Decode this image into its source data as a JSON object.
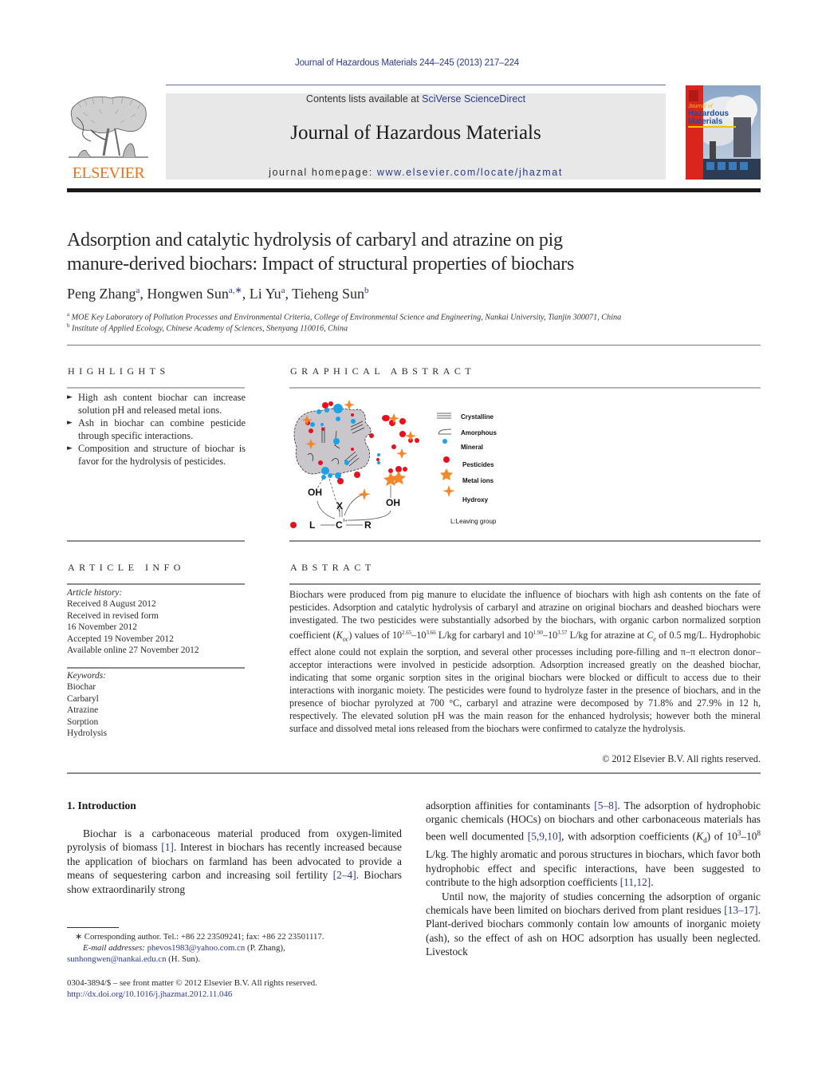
{
  "header": {
    "running_head": "Journal of Hazardous Materials 244–245 (2013) 217–224",
    "contents_prefix": "Contents lists available at ",
    "contents_link": "SciVerse ScienceDirect",
    "journal_title": "Journal of Hazardous Materials",
    "homepage_prefix": "journal homepage: ",
    "homepage_link": "www.elsevier.com/locate/jhazmat",
    "publisher_logo_text": "ELSEVIER",
    "cover": {
      "line1": "Journal of",
      "line2": "Hazardous",
      "line3": "Materials"
    }
  },
  "article": {
    "title_line1": "Adsorption and catalytic hydrolysis of carbaryl and atrazine on pig",
    "title_line2": "manure-derived biochars: Impact of structural properties of biochars",
    "authors": [
      {
        "name": "Peng Zhang",
        "sup": "a"
      },
      {
        "name": "Hongwen Sun",
        "sup": "a,∗"
      },
      {
        "name": "Li Yu",
        "sup": "a"
      },
      {
        "name": "Tieheng Sun",
        "sup": "b"
      }
    ],
    "affiliations": [
      {
        "sup": "a",
        "text": "MOE Key Laboratory of Pollution Processes and Environmental Criteria, College of Environmental Science and Engineering, Nankai University, Tianjin 300071, China"
      },
      {
        "sup": "b",
        "text": "Institute of Applied Ecology, Chinese Academy of Sciences, Shenyang 110016, China"
      }
    ]
  },
  "highlights": {
    "heading": "HIGHLIGHTS",
    "bullet": "►",
    "items": [
      "High ash content biochar can increase solution pH and released metal ions.",
      "Ash in biochar can combine pesticide through specific interactions.",
      "Composition and structure of biochar is favor for the hydrolysis of pesticides."
    ]
  },
  "graphical_abstract": {
    "heading": "GRAPHICAL ABSTRACT",
    "legend": [
      "Crystalline",
      "Amorphous",
      "Mineral",
      "Pesticides",
      "Metal ions",
      "Hydroxy"
    ],
    "leaving_group_note": "L:Leaving group",
    "labels": {
      "oh_left": "OH",
      "oh_right": "OH",
      "x": "X",
      "l": "L",
      "c": "C",
      "r": "R",
      "delta": "δ+"
    },
    "colors": {
      "mineral": "#1aa3e8",
      "pesticide": "#e8101c",
      "metal": "#f5862a",
      "particle": "#c9c6cc"
    }
  },
  "article_info": {
    "heading": "ARTICLE INFO",
    "history_label": "Article history:",
    "history": [
      "Received 8 August 2012",
      "Received in revised form",
      "16 November 2012",
      "Accepted 19 November 2012",
      "Available online 27 November 2012"
    ],
    "keywords_label": "Keywords:",
    "keywords": [
      "Biochar",
      "Carbaryl",
      "Atrazine",
      "Sorption",
      "Hydrolysis"
    ]
  },
  "abstract": {
    "heading": "ABSTRACT",
    "p1": "Biochars were produced from pig manure to elucidate the influence of biochars with high ash contents on the fate of pesticides. Adsorption and catalytic hydrolysis of carbaryl and atrazine on original biochars and deashed biochars were investigated. The two pesticides were substantially adsorbed by the biochars, with organic carbon normalized sorption coefficient (",
    "koc": "K",
    "koc_sub": "oc",
    "p2": ") values of 10",
    "e1": "2.65",
    "p3": "–10",
    "e2": "3.66",
    "p4": " L/kg for carbaryl and 10",
    "e3": "1.90",
    "p5": "–10",
    "e4": "3.57",
    "p6": " L/kg for atrazine at ",
    "ce": "C",
    "ce_sub": "e",
    "p7": " of 0.5 mg/L. Hydrophobic effect alone could not explain the sorption, and several other processes including pore-filling and π–π electron donor–acceptor interactions were involved in pesticide adsorption. Adsorption increased greatly on the deashed biochar, indicating that some organic sorption sites in the original biochars were blocked or difficult to access due to their interactions with inorganic moiety. The pesticides were found to hydrolyze faster in the presence of biochars, and in the presence of biochar pyrolyzed at 700 °C, carbaryl and atrazine were decomposed by 71.8% and 27.9% in 12 h, respectively. The elevated solution pH was the main reason for the enhanced hydrolysis; however both the mineral surface and dissolved metal ions released from the biochars were confirmed to catalyze the hydrolysis.",
    "copyright": "© 2012 Elsevier B.V. All rights reserved."
  },
  "introduction": {
    "heading": "1.  Introduction",
    "left_p1_a": "Biochar is a carbonaceous material produced from oxygen-limited pyrolysis of biomass ",
    "ref1": "[1]",
    "left_p1_b": ". Interest in biochars has recently increased because the application of biochars on farmland has been advocated to provide a means of sequestering carbon and increasing soil fertility ",
    "ref2": "[2–4]",
    "left_p1_c": ". Biochars show extraordinarily strong",
    "right_p1_a": "adsorption affinities for contaminants ",
    "ref3": "[5–8]",
    "right_p1_b": ". The adsorption of hydrophobic organic chemicals (HOCs) on biochars and other carbonaceous materials has been well documented ",
    "ref4": "[5,9,10]",
    "right_p1_c": ", with adsorption coefficients (",
    "kd": "K",
    "kd_sub": "d",
    "right_p1_d": ") of 10",
    "e5": "3",
    "right_p1_e": "–10",
    "e6": "8",
    "right_p1_f": " L/kg. The highly aromatic and porous structures in biochars, which favor both hydrophobic effect and specific interactions, have been suggested to contribute to the high adsorption coefficients ",
    "ref5": "[11,12]",
    "right_p1_g": ".",
    "right_p2_a": "Until now, the majority of studies concerning the adsorption of organic chemicals have been limited on biochars derived from plant residues ",
    "ref6": "[13–17]",
    "right_p2_b": ". Plant-derived biochars commonly contain low amounts of inorganic moiety (ash), so the effect of ash on HOC adsorption has usually been neglected. Livestock"
  },
  "footnotes": {
    "corresponding": "∗ Corresponding author. Tel.: +86 22 23509241; fax: +86 22 23501117.",
    "email_label": "E-mail addresses: ",
    "email1": "phevos1983@yahoo.com.cn",
    "email1_owner": " (P. Zhang),",
    "email2": "sunhongwen@nankai.edu.cn",
    "email2_owner": " (H. Sun).",
    "issn": "0304-3894/$ – see front matter © 2012 Elsevier B.V. All rights reserved.",
    "doi": "http://dx.doi.org/10.1016/j.jhazmat.2012.11.046"
  }
}
